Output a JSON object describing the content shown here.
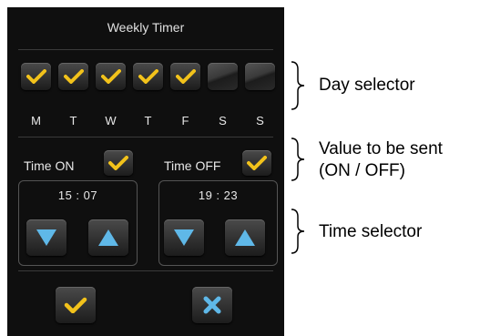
{
  "dialog": {
    "title": "Weekly Timer",
    "days": [
      {
        "label": "M",
        "checked": true
      },
      {
        "label": "T",
        "checked": true
      },
      {
        "label": "W",
        "checked": true
      },
      {
        "label": "T",
        "checked": true
      },
      {
        "label": "F",
        "checked": true
      },
      {
        "label": "S",
        "checked": false
      },
      {
        "label": "S",
        "checked": false
      }
    ],
    "time_on": {
      "label": "Time ON",
      "checked": true,
      "time": "15 : 07"
    },
    "time_off": {
      "label": "Time OFF",
      "checked": true,
      "time": "19 : 23"
    },
    "icons": {
      "check": "check-icon",
      "cross": "close-icon",
      "down": "arrow-down-icon",
      "up": "arrow-up-icon"
    }
  },
  "annotations": {
    "day_selector": "Day selector",
    "value_line1": "Value to be sent",
    "value_line2": "(ON / OFF)",
    "time_selector": "Time selector"
  },
  "colors": {
    "panel_bg": "#0f0f0f",
    "check_yellow": "#f2c21b",
    "arrow_blue": "#5fb8e8"
  }
}
